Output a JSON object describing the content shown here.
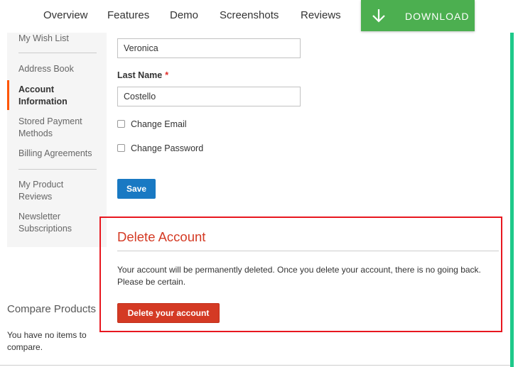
{
  "topnav": {
    "links": [
      "Overview",
      "Features",
      "Demo",
      "Screenshots",
      "Reviews"
    ],
    "download_label": "DOWNLOAD",
    "download_icon": "arrow-down-icon",
    "download_color": "#4caf50"
  },
  "sidebar": {
    "items": {
      "wish_list": "My Wish List",
      "address_book": "Address Book",
      "account_information": "Account Information",
      "stored_payment": "Stored Payment Methods",
      "billing_agreements": "Billing Agreements",
      "product_reviews": "My Product Reviews",
      "newsletter": "Newsletter Subscriptions"
    },
    "active_item": "Account Information",
    "active_accent": "#ff5501"
  },
  "compare": {
    "title": "Compare Products",
    "text": "You have no items to compare."
  },
  "form": {
    "first_name_value": "Veronica",
    "last_name_label": "Last Name",
    "required_marker": "*",
    "last_name_value": "Costello",
    "change_email_label": "Change Email",
    "change_password_label": "Change Password",
    "save_label": "Save",
    "save_color": "#1979c3"
  },
  "delete_account": {
    "title": "Delete Account",
    "message": "Your account will be permanently deleted. Once you delete your account, there is no going back. Please be certain.",
    "button_label": "Delete your account",
    "highlight_color": "#e8171f",
    "button_color": "#d43a24"
  },
  "scroll_accent_color": "#1fc98a"
}
